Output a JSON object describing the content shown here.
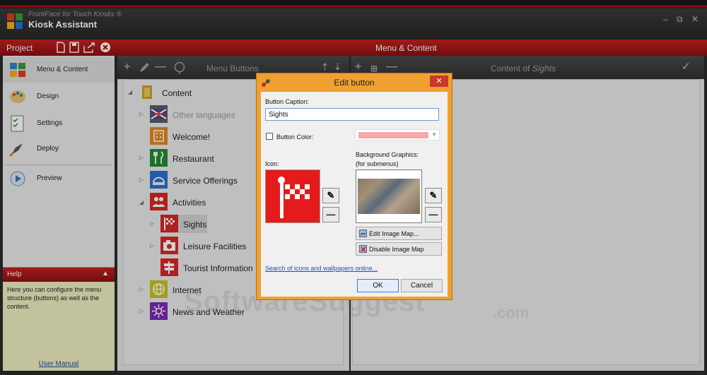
{
  "app": {
    "title": "FrontFace for Touch Kiosks ®",
    "subtitle": "Kiosk Assistant",
    "controls": {
      "minimize": "–",
      "restore": "⧉",
      "close": "✕"
    }
  },
  "project": {
    "label": "Project"
  },
  "sidebar": {
    "items": [
      {
        "label": "Menu & Content",
        "icon": "grid-icon"
      },
      {
        "label": "Design",
        "icon": "palette-icon"
      },
      {
        "label": "Settings",
        "icon": "checklist-icon"
      },
      {
        "label": "Deploy",
        "icon": "rocket-icon"
      },
      {
        "label": "Preview",
        "icon": "play-icon"
      }
    ]
  },
  "help": {
    "title": "Help",
    "text": "Here you can configure the menu structure (buttons) as well as the content.",
    "manual_link": "User Manual"
  },
  "center_header": "Menu & Content",
  "menu_panel": {
    "title": "Menu Buttons",
    "tree": [
      {
        "label": "Content",
        "color": "#c8a030"
      },
      {
        "label": "Other languages",
        "color": "#5a5a6a"
      },
      {
        "label": "Welcome!",
        "color": "#e08a20"
      },
      {
        "label": "Restaurant",
        "color": "#228a30"
      },
      {
        "label": "Service Offerings",
        "color": "#2a6fd0"
      },
      {
        "label": "Activities",
        "color": "#d82626"
      },
      {
        "label": "Sights",
        "color": "#d82626"
      },
      {
        "label": "Leisure Facilities",
        "color": "#d82626"
      },
      {
        "label": "Tourist Information",
        "color": "#d82626"
      },
      {
        "label": "Internet",
        "color": "#c8c020"
      },
      {
        "label": "News and Weather",
        "color": "#7a2ab0"
      }
    ]
  },
  "content_panel": {
    "title_prefix": "Content of ",
    "title_item": "Sights"
  },
  "dialog": {
    "title": "Edit button",
    "caption_label": "Button Caption:",
    "caption_value": "Sights",
    "color_label": "Button Color:",
    "color_value": "#f4aaaa",
    "icon_label": "Icon:",
    "bg_label": "Background Graphics:",
    "bg_sub": "(for submenus)",
    "edit_map": "Edit Image Map...",
    "disable_map": "Disable Image Map",
    "search_link": "Search of icons and wallpapers online...",
    "ok": "OK",
    "cancel": "Cancel",
    "close": "✕"
  },
  "watermark": {
    "main": "SoftwareSuggest",
    "tld": ".com"
  }
}
